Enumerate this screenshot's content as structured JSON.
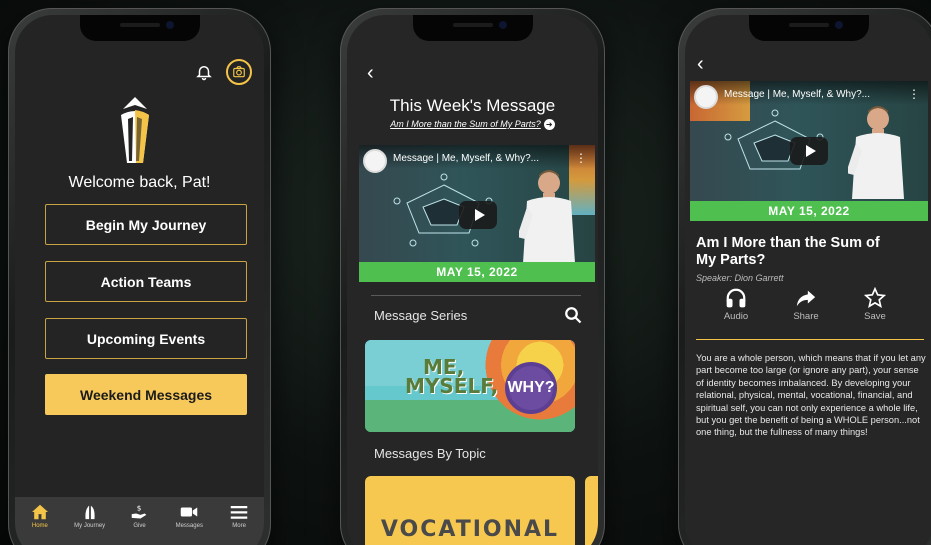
{
  "phone1": {
    "welcome": "Welcome back, Pat!",
    "menu": [
      {
        "label": "Begin My Journey"
      },
      {
        "label": "Action Teams"
      },
      {
        "label": "Upcoming Events"
      },
      {
        "label": "Weekend Messages"
      }
    ],
    "tabs": [
      {
        "label": "Home",
        "icon": "home-icon"
      },
      {
        "label": "My Journey",
        "icon": "journey-icon"
      },
      {
        "label": "Give",
        "icon": "give-icon"
      },
      {
        "label": "Messages",
        "icon": "video-icon"
      },
      {
        "label": "More",
        "icon": "menu-icon"
      }
    ],
    "accent": "#f3c448"
  },
  "phone2": {
    "title": "This Week's Message",
    "subtitle": "Am I More than the Sum of My Parts?",
    "video_title": "Message | Me, Myself, & Why?...",
    "video_date": "MAY 15, 2022",
    "series_label": "Message Series",
    "series_art": {
      "line1": "ME,",
      "line2": "MYSELF, &",
      "why": "WHY?"
    },
    "topics_label": "Messages By Topic",
    "topic": "VOCATIONAL"
  },
  "phone3": {
    "video_title": "Message | Me, Myself, & Why?...",
    "video_date": "MAY 15, 2022",
    "message_title": "Am I More than the Sum of My Parts?",
    "speaker": "Speaker: Dion Garrett",
    "actions": [
      {
        "label": "Audio",
        "icon": "headphones-icon"
      },
      {
        "label": "Share",
        "icon": "share-icon"
      },
      {
        "label": "Save",
        "icon": "star-icon"
      }
    ],
    "description": "You are a whole person, which means that if you let any part become too large (or ignore any part), your sense of identity becomes imbalanced. By developing your relational, physical, mental, vocational, financial, and spiritual self, you can not only experience a whole life, but you get the benefit of being a WHOLE person...not one thing, but the fullness of many things!"
  }
}
